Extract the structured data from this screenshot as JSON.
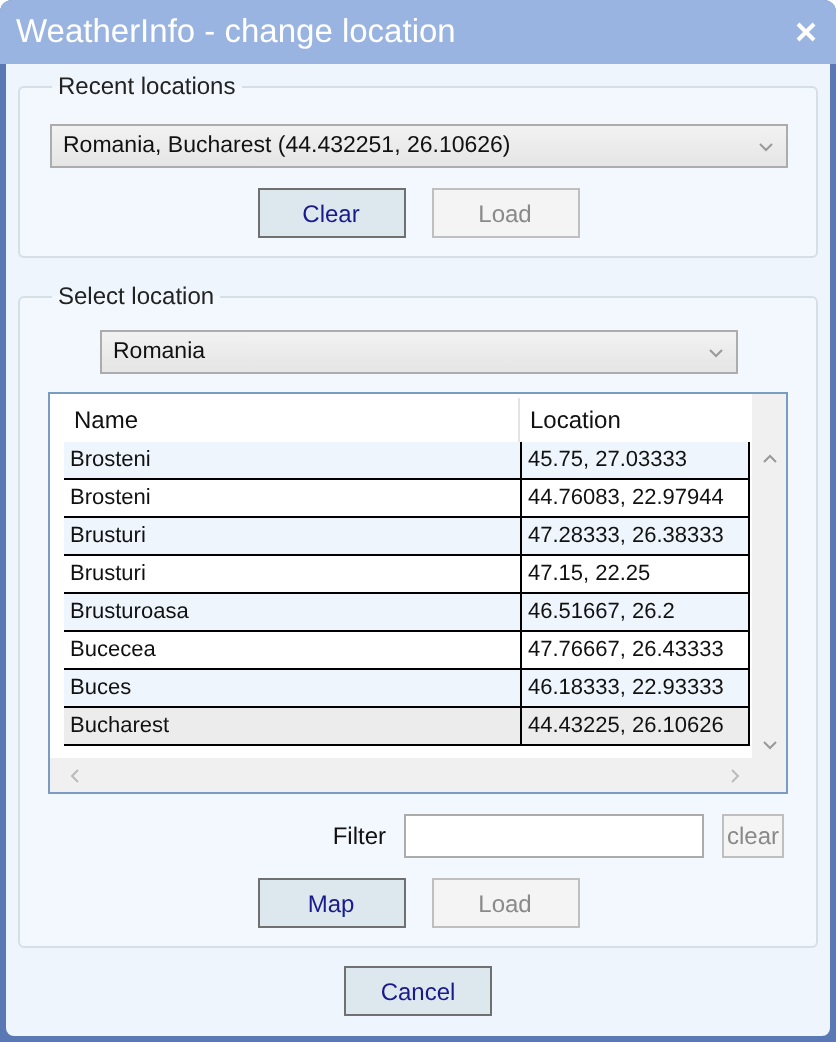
{
  "window": {
    "title": "WeatherInfo - change location"
  },
  "recent": {
    "legend": "Recent locations",
    "value": "Romania, Bucharest (44.432251, 26.10626)",
    "buttons": [
      {
        "label": "Clear",
        "disabled": false
      },
      {
        "label": "Load",
        "disabled": true
      }
    ]
  },
  "select": {
    "legend": "Select location",
    "country": "Romania",
    "table": {
      "columns": [
        "Name",
        "Location"
      ],
      "rows": [
        {
          "name": "Brosteni",
          "location": "45.75, 27.03333",
          "selected": false
        },
        {
          "name": "Brosteni",
          "location": "44.76083, 22.97944",
          "selected": false
        },
        {
          "name": "Brusturi",
          "location": "47.28333, 26.38333",
          "selected": false
        },
        {
          "name": "Brusturi",
          "location": "47.15, 22.25",
          "selected": false
        },
        {
          "name": "Brusturoasa",
          "location": "46.51667, 26.2",
          "selected": false
        },
        {
          "name": "Bucecea",
          "location": "47.76667, 26.43333",
          "selected": false
        },
        {
          "name": "Buces",
          "location": "46.18333, 22.93333",
          "selected": false
        },
        {
          "name": "Bucharest",
          "location": "44.43225, 26.10626",
          "selected": true
        }
      ]
    },
    "filter": {
      "label": "Filter",
      "clear": {
        "label": "clear",
        "disabled": true
      }
    },
    "buttons": [
      {
        "label": "Map",
        "disabled": false
      },
      {
        "label": "Load",
        "disabled": true
      }
    ]
  },
  "footer": {
    "buttons": [
      {
        "label": "Cancel",
        "disabled": false
      }
    ]
  }
}
